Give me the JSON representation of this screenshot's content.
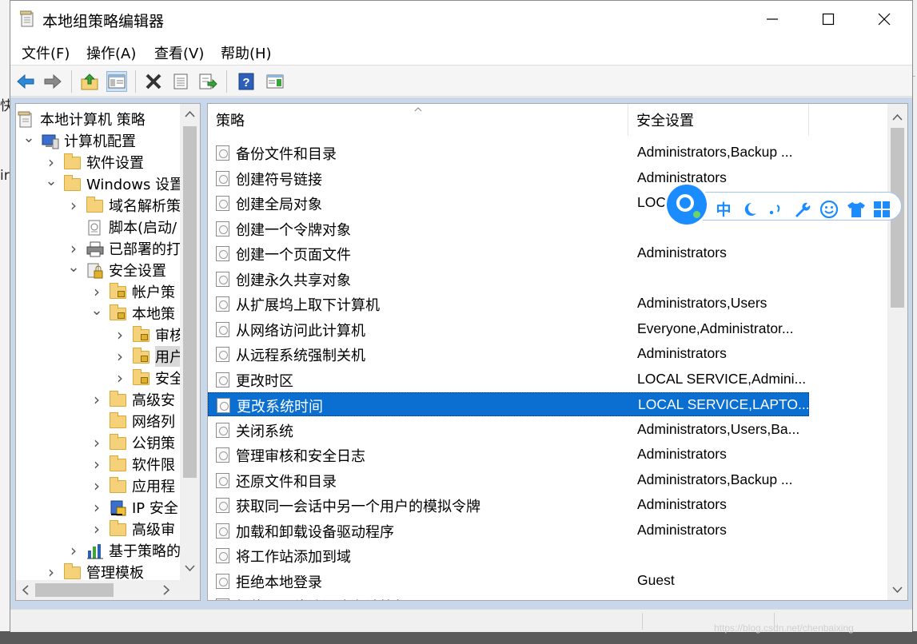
{
  "window": {
    "title": "本地组策略编辑器"
  },
  "menu": [
    "文件(F)",
    "操作(A)",
    "查看(V)",
    "帮助(H)"
  ],
  "background_text": {
    "left_1": "快",
    "left_2": "ir"
  },
  "tree": [
    {
      "label": "本地计算机 策略",
      "level": 0,
      "exp": "",
      "icon": "policy-doc-icon"
    },
    {
      "label": "计算机配置",
      "level": 1,
      "exp": "open",
      "icon": "computer-icon"
    },
    {
      "label": "软件设置",
      "level": 2,
      "exp": "closed",
      "icon": "folder-icon"
    },
    {
      "label": "Windows 设置",
      "level": 2,
      "exp": "open",
      "icon": "folder-icon"
    },
    {
      "label": "域名解析策",
      "level": 3,
      "exp": "closed",
      "icon": "folder-icon"
    },
    {
      "label": "脚本(启动/",
      "level": 3,
      "exp": "",
      "icon": "script-icon"
    },
    {
      "label": "已部署的打",
      "level": 3,
      "exp": "closed",
      "icon": "printer-icon"
    },
    {
      "label": "安全设置",
      "level": 3,
      "exp": "open",
      "icon": "security-icon"
    },
    {
      "label": "帐户策",
      "level": 4,
      "exp": "closed",
      "icon": "lock-folder-icon"
    },
    {
      "label": "本地策",
      "level": 4,
      "exp": "open",
      "icon": "lock-folder-icon"
    },
    {
      "label": "审核",
      "level": 5,
      "exp": "closed",
      "icon": "lock-folder-icon"
    },
    {
      "label": "用户",
      "level": 5,
      "exp": "closed",
      "icon": "lock-folder-icon",
      "selected": true
    },
    {
      "label": "安全",
      "level": 5,
      "exp": "closed",
      "icon": "lock-folder-icon"
    },
    {
      "label": "高级安",
      "level": 4,
      "exp": "closed",
      "icon": "folder-icon"
    },
    {
      "label": "网络列",
      "level": 4,
      "exp": "",
      "icon": "folder-icon"
    },
    {
      "label": "公钥策",
      "level": 4,
      "exp": "closed",
      "icon": "folder-icon"
    },
    {
      "label": "软件限",
      "level": 4,
      "exp": "closed",
      "icon": "folder-icon"
    },
    {
      "label": "应用程",
      "level": 4,
      "exp": "closed",
      "icon": "folder-icon"
    },
    {
      "label": "IP 安全",
      "level": 4,
      "exp": "closed",
      "icon": "ip-security-icon"
    },
    {
      "label": "高级审",
      "level": 4,
      "exp": "closed",
      "icon": "folder-icon"
    },
    {
      "label": "基于策略的",
      "level": 3,
      "exp": "closed",
      "icon": "chart-icon"
    },
    {
      "label": "管理模板",
      "level": 2,
      "exp": "closed",
      "icon": "folder-icon"
    }
  ],
  "list": {
    "columns": [
      "策略",
      "安全设置"
    ],
    "rows": [
      {
        "policy": "备份文件和目录",
        "setting": "Administrators,Backup ..."
      },
      {
        "policy": "创建符号链接",
        "setting": "Administrators"
      },
      {
        "policy": "创建全局对象",
        "setting": "LOCA"
      },
      {
        "policy": "创建一个令牌对象",
        "setting": ""
      },
      {
        "policy": "创建一个页面文件",
        "setting": "Administrators"
      },
      {
        "policy": "创建永久共享对象",
        "setting": ""
      },
      {
        "policy": "从扩展坞上取下计算机",
        "setting": "Administrators,Users"
      },
      {
        "policy": "从网络访问此计算机",
        "setting": "Everyone,Administrator..."
      },
      {
        "policy": "从远程系统强制关机",
        "setting": "Administrators"
      },
      {
        "policy": "更改时区",
        "setting": "LOCAL SERVICE,Admini..."
      },
      {
        "policy": "更改系统时间",
        "setting": "LOCAL SERVICE,LAPTO...",
        "selected": true
      },
      {
        "policy": "关闭系统",
        "setting": "Administrators,Users,Ba..."
      },
      {
        "policy": "管理审核和安全日志",
        "setting": "Administrators"
      },
      {
        "policy": "还原文件和目录",
        "setting": "Administrators,Backup ..."
      },
      {
        "policy": "获取同一会话中另一个用户的模拟令牌",
        "setting": "Administrators"
      },
      {
        "policy": "加载和卸载设备驱动程序",
        "setting": "Administrators"
      },
      {
        "policy": "将工作站添加到域",
        "setting": ""
      },
      {
        "policy": "拒绝本地登录",
        "setting": "Guest"
      },
      {
        "policy": "拒绝从网络访问这台计算机",
        "setting": "Guest"
      }
    ]
  },
  "ime": {
    "lang": "中"
  },
  "watermark": "https://blog.csdn.net/chenbaixing",
  "colors": {
    "selection": "#0a6fd0",
    "ime_accent": "#1a8cff",
    "folder": "#f5d27a"
  }
}
